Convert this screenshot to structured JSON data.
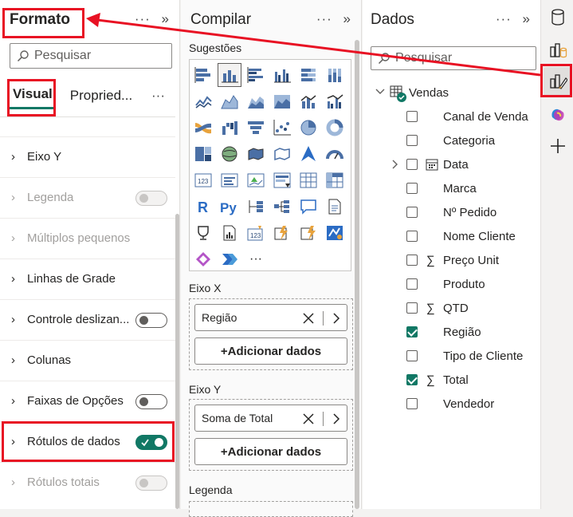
{
  "format_pane": {
    "title": "Formato",
    "search_placeholder": "Pesquisar",
    "tabs": [
      {
        "label": "Visual",
        "active": true
      },
      {
        "label": "Propried..."
      }
    ],
    "more": "···",
    "items": [
      {
        "label": "Eixo Y",
        "disabled": false,
        "toggle": null
      },
      {
        "label": "Legenda",
        "disabled": true,
        "toggle": "off"
      },
      {
        "label": "Múltiplos pequenos",
        "disabled": true,
        "toggle": null
      },
      {
        "label": "Linhas de Grade",
        "disabled": false,
        "toggle": null
      },
      {
        "label": "Controle deslizan...",
        "disabled": false,
        "toggle": "off"
      },
      {
        "label": "Colunas",
        "disabled": false,
        "toggle": null
      },
      {
        "label": "Faixas de Opções",
        "disabled": false,
        "toggle": "off"
      },
      {
        "label": "Rótulos de dados",
        "disabled": false,
        "toggle": "on"
      },
      {
        "label": "Rótulos totais",
        "disabled": true,
        "toggle": "off"
      }
    ]
  },
  "build_pane": {
    "title": "Compilar",
    "suggestions_label": "Sugestões",
    "x_axis_label": "Eixo X",
    "x_axis_field": "Região",
    "y_axis_label": "Eixo Y",
    "y_axis_field": "Soma de Total",
    "add_data": "+Adicionar dados",
    "legend_label": "Legenda",
    "more_visuals": "···"
  },
  "data_pane": {
    "title": "Dados",
    "search_placeholder": "Pesquisar",
    "table_name": "Vendas",
    "fields": [
      {
        "label": "Canal de Venda",
        "checked": false,
        "sigma": false
      },
      {
        "label": "Categoria",
        "checked": false,
        "sigma": false
      },
      {
        "label": "Data",
        "checked": false,
        "sigma": false,
        "expandable": true,
        "calendar": true
      },
      {
        "label": "Marca",
        "checked": false,
        "sigma": false
      },
      {
        "label": "Nº Pedido",
        "checked": false,
        "sigma": false
      },
      {
        "label": "Nome Cliente",
        "checked": false,
        "sigma": false
      },
      {
        "label": "Preço Unit",
        "checked": false,
        "sigma": true
      },
      {
        "label": "Produto",
        "checked": false,
        "sigma": false
      },
      {
        "label": "QTD",
        "checked": false,
        "sigma": true
      },
      {
        "label": "Região",
        "checked": true,
        "sigma": false
      },
      {
        "label": "Tipo de Cliente",
        "checked": false,
        "sigma": false
      },
      {
        "label": "Total",
        "checked": true,
        "sigma": true
      },
      {
        "label": "Vendedor",
        "checked": false,
        "sigma": false
      }
    ]
  },
  "pane_controls": {
    "more": "···",
    "collapse": "»"
  },
  "colors": {
    "accent": "#117865",
    "annotation": "#e81123"
  }
}
